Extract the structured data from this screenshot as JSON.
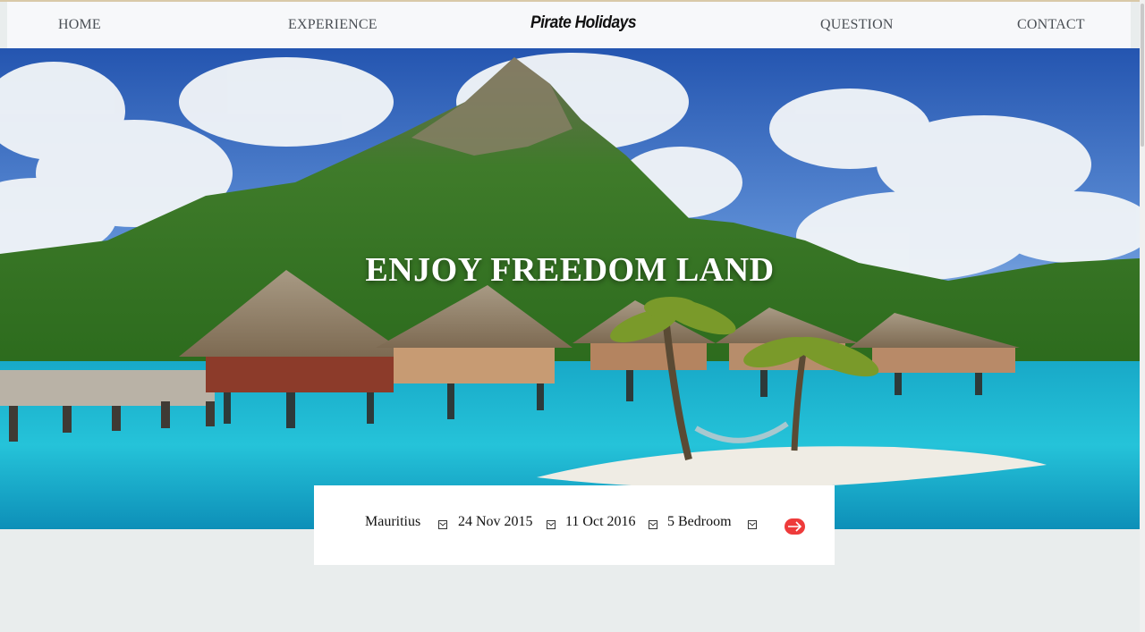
{
  "nav": {
    "home": "HOME",
    "experience": "EXPERIENCE",
    "brand": "Pirate Holidays",
    "question": "QUESTION",
    "contact": "CONTACT"
  },
  "hero": {
    "title": "ENJOY FREEDOM LAND"
  },
  "search": {
    "destination": "Mauritius",
    "check_in": "24 Nov 2015",
    "check_out": "11 Oct 2016",
    "rooms": "5 Bedroom",
    "go_icon": "arrow-right-icon"
  },
  "colors": {
    "go_button": "#ee3b3b",
    "sea": "#1fb7d4",
    "sky": "#2f6fc4"
  }
}
